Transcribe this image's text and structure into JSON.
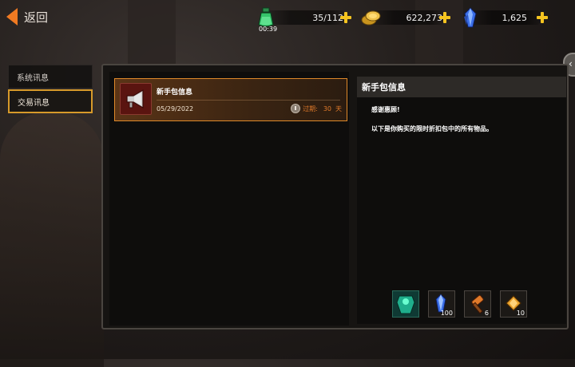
{
  "header": {
    "back_label": "返回"
  },
  "resources": {
    "stamina": {
      "icon": "green-potion-icon",
      "value": "35/112",
      "timer": "00:39"
    },
    "gold": {
      "icon": "gold-coins-icon",
      "value": "622,273"
    },
    "gems": {
      "icon": "blue-crystal-icon",
      "value": "1,625"
    }
  },
  "tabs": [
    {
      "label": "系统讯息",
      "selected": false
    },
    {
      "label": "交易讯息",
      "selected": true
    }
  ],
  "mail_list": [
    {
      "title": "新手包信息",
      "date": "05/29/2022",
      "expire_label": "过期:",
      "expire_days": "30",
      "expire_unit": "天",
      "icon": "megaphone-icon"
    }
  ],
  "detail": {
    "title": "新手包信息",
    "line1": "感谢惠顾!",
    "line2": "以下是你购买的限时折扣包中的所有物品。",
    "rewards": [
      {
        "icon": "green-armor-icon",
        "qty": ""
      },
      {
        "icon": "blue-crystal-icon",
        "qty": "100"
      },
      {
        "icon": "orange-hammer-icon",
        "qty": "6"
      },
      {
        "icon": "orange-gem-icon",
        "qty": "10"
      }
    ]
  },
  "colors": {
    "accent": "#f07a22",
    "highlight_border": "#d79a2a",
    "expire_text": "#e07a2a"
  }
}
